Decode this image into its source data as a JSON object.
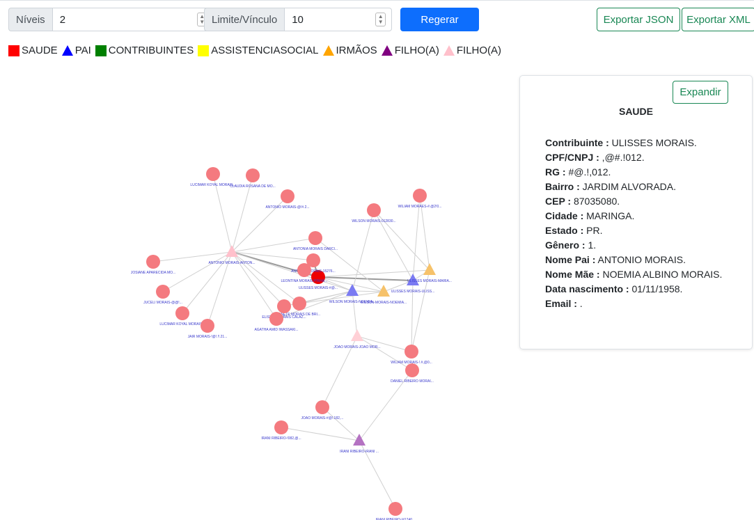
{
  "toolbar": {
    "levels_label": "Níveis",
    "levels_value": "2",
    "limit_label": "Limite/Vínculo",
    "limit_value": "10",
    "regenerate_label": "Regerar",
    "export_json_label": "Exportar JSON",
    "export_xml_label": "Exportar XML"
  },
  "legend": [
    {
      "label": "SAUDE",
      "shape": "square",
      "color": "#ff0000"
    },
    {
      "label": "PAI",
      "shape": "triangle",
      "color": "#0000ff"
    },
    {
      "label": "CONTRIBUINTES",
      "shape": "square",
      "color": "#008000"
    },
    {
      "label": "ASSISTENCIASOCIAL",
      "shape": "square",
      "color": "#ffff00"
    },
    {
      "label": "IRMÃOS",
      "shape": "triangle",
      "color": "#ffa500"
    },
    {
      "label": "FILHO(A)",
      "shape": "triangle",
      "color": "#800080"
    },
    {
      "label": "FILHO(A)",
      "shape": "triangle",
      "color": "#ffc0cb"
    }
  ],
  "graph": {
    "nodes": [
      {
        "id": "um",
        "label": "ULISSES MORAIS-#@...",
        "shape": "circle",
        "color": "#ee0000"
      },
      {
        "id": "am",
        "label": "ANTONIO MORAIS-ANTON...",
        "shape": "triangle",
        "color": "#ffc0cb"
      },
      {
        "id": "wm",
        "label": "WILSON MORAIS-NOEMIA...",
        "shape": "triangle",
        "color": "#7b7bf2"
      },
      {
        "id": "uu",
        "label": "ULISSES MORAIS-ULISS...",
        "shape": "triangle",
        "color": "#7b7bf2"
      },
      {
        "id": "um2",
        "label": "ULISSES MORAIS-MARIA...",
        "shape": "triangle",
        "color": "#f6c26a"
      },
      {
        "id": "wn",
        "label": "WILSON MORAIS-NOEMIA...",
        "shape": "triangle",
        "color": "#f6c26a"
      },
      {
        "id": "jm",
        "label": "JOAO MORAIS-JOAO MOR...",
        "shape": "triangle",
        "color": "#ffd0d6"
      },
      {
        "id": "ir",
        "label": "IRANI RIBEIRO-IRANI ...",
        "shape": "triangle",
        "color": "#b472c2"
      },
      {
        "id": "n1",
        "label": "LUCIMAR KOYAL MORAIS...",
        "shape": "circle",
        "color": "#f47a7f"
      },
      {
        "id": "n2",
        "label": "CLAUDIA ROSANA DE MO...",
        "shape": "circle",
        "color": "#f47a7f"
      },
      {
        "id": "n3",
        "label": "ANTONIO MORAIS-@!#.2...",
        "shape": "circle",
        "color": "#f47a7f"
      },
      {
        "id": "n4",
        "label": "ANTONIA MORAIS DARCI...",
        "shape": "circle",
        "color": "#f47a7f"
      },
      {
        "id": "n5",
        "label": "ANTONIO MORAIS-15276...",
        "shape": "circle",
        "color": "#f47a7f"
      },
      {
        "id": "n6",
        "label": "LEONTINA MORAIS-PINHA...",
        "shape": "circle",
        "color": "#f47a7f"
      },
      {
        "id": "n7",
        "label": "JOSIANE APARECIDA MO...",
        "shape": "circle",
        "color": "#f47a7f"
      },
      {
        "id": "n8",
        "label": "JUCELI MORAIS-@@!...",
        "shape": "circle",
        "color": "#f47a7f"
      },
      {
        "id": "n9",
        "label": "LUCIMAR KOYAL MORAIS...",
        "shape": "circle",
        "color": "#f47a7f"
      },
      {
        "id": "n10",
        "label": "JAIR MORAIS-!@!.!!.21...",
        "shape": "circle",
        "color": "#f47a7f"
      },
      {
        "id": "n11",
        "label": "ANETE MORAIS DE BRI...",
        "shape": "circle",
        "color": "#f47a7f"
      },
      {
        "id": "n12",
        "label": "ELISETE MORAIS CALAZ...",
        "shape": "circle",
        "color": "#f47a7f"
      },
      {
        "id": "n13",
        "label": "AGATHA AMID IWASSAKI...",
        "shape": "circle",
        "color": "#f47a7f"
      },
      {
        "id": "n14",
        "label": "WILSON MORAIS-012830...",
        "shape": "circle",
        "color": "#f47a7f"
      },
      {
        "id": "n15",
        "label": "WILIAM MORAES-#.@2!0...",
        "shape": "circle",
        "color": "#f47a7f"
      },
      {
        "id": "n16",
        "label": "WILIAM MORAIS-!.#,@0...",
        "shape": "circle",
        "color": "#f47a7f"
      },
      {
        "id": "n17",
        "label": "DANIEL RIBEIRO MORAI...",
        "shape": "circle",
        "color": "#f47a7f"
      },
      {
        "id": "n18",
        "label": "JOAO MORAIS-#@!.182,...",
        "shape": "circle",
        "color": "#f47a7f"
      },
      {
        "id": "n19",
        "label": "IRANI RIBEIRO-!082,@...",
        "shape": "circle",
        "color": "#f47a7f"
      },
      {
        "id": "n20",
        "label": "IRANI RIBEIRO-!#1740...",
        "shape": "circle",
        "color": "#f47a7f"
      }
    ],
    "edges": [
      [
        "am",
        "n1"
      ],
      [
        "am",
        "n2"
      ],
      [
        "am",
        "n3"
      ],
      [
        "am",
        "n4"
      ],
      [
        "am",
        "n5"
      ],
      [
        "am",
        "n7"
      ],
      [
        "am",
        "n8"
      ],
      [
        "am",
        "n9"
      ],
      [
        "am",
        "n10"
      ],
      [
        "am",
        "n11"
      ],
      [
        "am",
        "n12"
      ],
      [
        "am",
        "um"
      ],
      [
        "am",
        "n13"
      ],
      [
        "am",
        "wm"
      ],
      [
        "um",
        "wm"
      ],
      [
        "um",
        "uu"
      ],
      [
        "um",
        "um2"
      ],
      [
        "um",
        "wn"
      ],
      [
        "um",
        "n6"
      ],
      [
        "um",
        "n5"
      ],
      [
        "wm",
        "n14"
      ],
      [
        "wm",
        "n11"
      ],
      [
        "wm",
        "n12"
      ],
      [
        "wm",
        "n13"
      ],
      [
        "wm",
        "wn"
      ],
      [
        "wm",
        "jm"
      ],
      [
        "uu",
        "n15"
      ],
      [
        "uu",
        "n16"
      ],
      [
        "uu",
        "n14"
      ],
      [
        "uu",
        "um2"
      ],
      [
        "uu",
        "wn"
      ],
      [
        "um2",
        "n14"
      ],
      [
        "um2",
        "n15"
      ],
      [
        "um2",
        "n16"
      ],
      [
        "n4",
        "wn"
      ],
      [
        "n11",
        "wn"
      ],
      [
        "jm",
        "n18"
      ],
      [
        "jm",
        "n16"
      ],
      [
        "jm",
        "n17"
      ],
      [
        "ir",
        "n19"
      ],
      [
        "ir",
        "n20"
      ],
      [
        "ir",
        "n17"
      ],
      [
        "ir",
        "n18"
      ]
    ]
  },
  "details": {
    "expand_label": "Expandir",
    "title": "SAUDE",
    "fields": [
      {
        "key": "Contribuinte :",
        "value": " ULISSES MORAIS."
      },
      {
        "key": "CPF/CNPJ :",
        "value": " ,@#.!012."
      },
      {
        "key": "RG :",
        "value": " #@.!,012."
      },
      {
        "key": "Bairro :",
        "value": " JARDIM ALVORADA."
      },
      {
        "key": "CEP :",
        "value": " 87035080."
      },
      {
        "key": "Cidade :",
        "value": " MARINGA."
      },
      {
        "key": "Estado :",
        "value": " PR."
      },
      {
        "key": "Gênero :",
        "value": " 1."
      },
      {
        "key": "Nome Pai :",
        "value": " ANTONIO MORAIS."
      },
      {
        "key": "Nome Mãe :",
        "value": " NOEMIA ALBINO MORAIS."
      },
      {
        "key": "Data nascimento :",
        "value": " 01/11/1958."
      },
      {
        "key": "Email :",
        "value": " ."
      }
    ]
  }
}
